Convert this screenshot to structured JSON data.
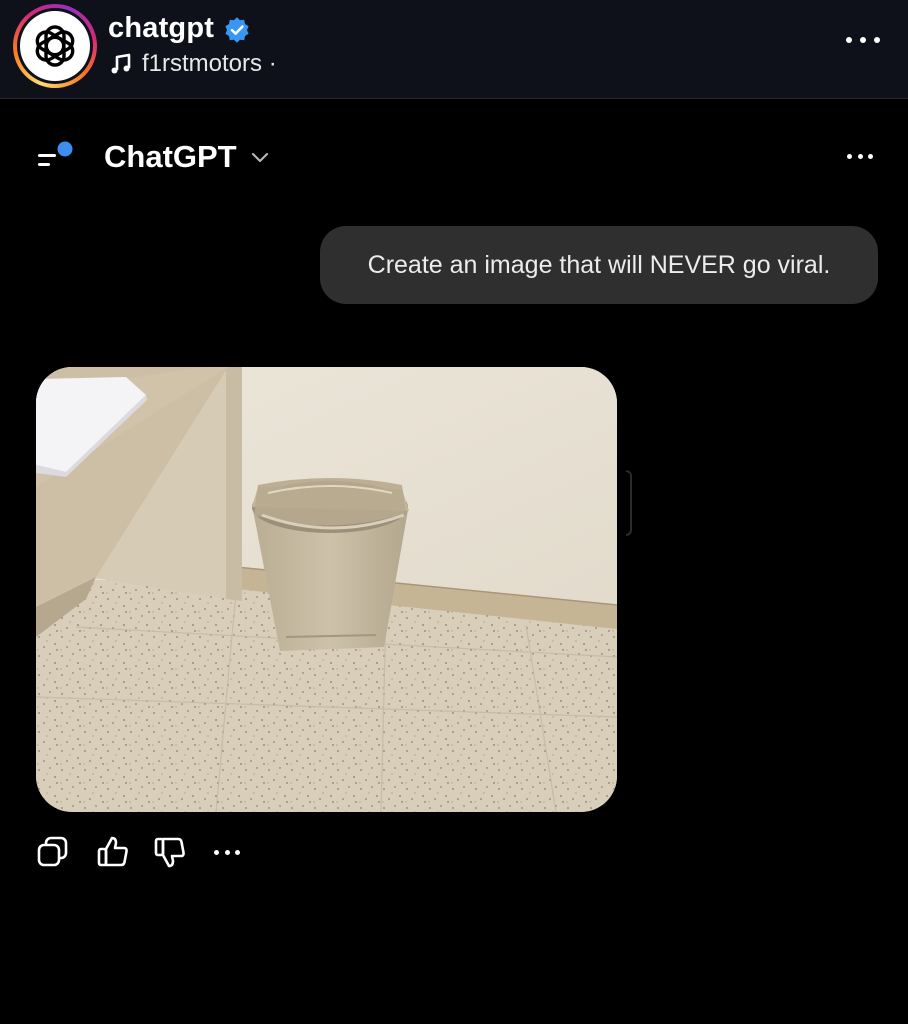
{
  "post": {
    "account_name": "chatgpt",
    "music_label": "f1rstmotors ·"
  },
  "app": {
    "title": "ChatGPT"
  },
  "chat": {
    "user_message": "Create an image that will NEVER go viral."
  },
  "icons": {
    "avatar": "openai-logo-icon",
    "verified": "verified-badge-icon",
    "music": "music-note-icon",
    "post_more": "more-horizontal-icon",
    "menu": "sidebar-menu-icon",
    "chevron": "chevron-down-icon",
    "app_more": "more-horizontal-icon",
    "actions": [
      "copy-icon",
      "thumbs-up-icon",
      "thumbs-down-icon",
      "more-horizontal-icon"
    ]
  },
  "colors": {
    "background": "#000000",
    "header_bg": "#0f111a",
    "bubble_bg": "#2f2f2f",
    "verified_blue": "#3897f0",
    "notification_dot": "#3b8ef0"
  }
}
